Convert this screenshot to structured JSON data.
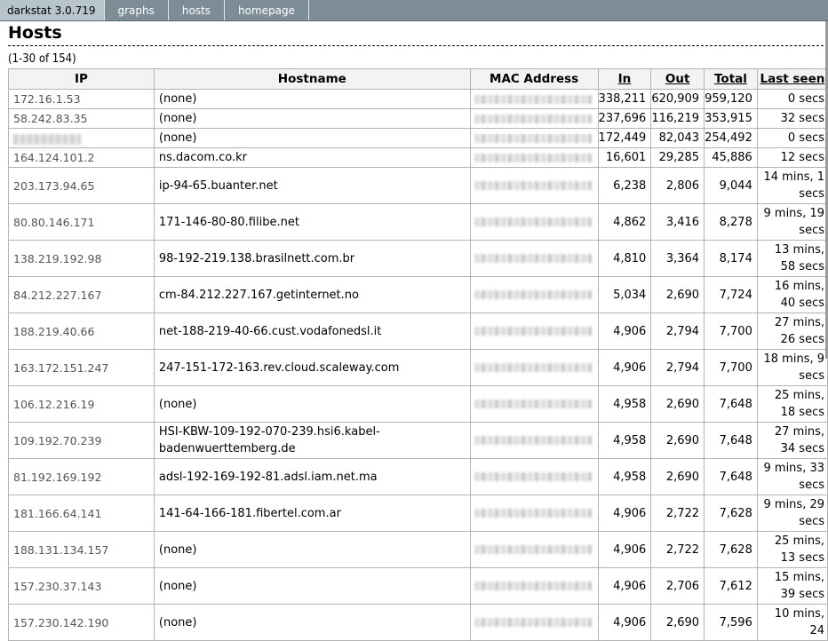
{
  "nav": {
    "brand": "darkstat 3.0.719",
    "links": [
      "graphs",
      "hosts",
      "homepage"
    ]
  },
  "page": {
    "title": "Hosts",
    "count": "(1-30 of 154)"
  },
  "table": {
    "headers": [
      "IP",
      "Hostname",
      "MAC Address",
      "In",
      "Out",
      "Total",
      "Last seen"
    ],
    "rows": [
      {
        "ip": "172.16.1.53",
        "host": "(none)",
        "in": "338,211",
        "out": "620,909",
        "total": "959,120",
        "seen": "0 secs"
      },
      {
        "ip": "58.242.83.35",
        "host": "(none)",
        "in": "237,696",
        "out": "116,219",
        "total": "353,915",
        "seen": "32 secs"
      },
      {
        "ip": "",
        "host": "(none)",
        "in": "172,449",
        "out": "82,043",
        "total": "254,492",
        "seen": "0 secs"
      },
      {
        "ip": "164.124.101.2",
        "host": "ns.dacom.co.kr",
        "in": "16,601",
        "out": "29,285",
        "total": "45,886",
        "seen": "12 secs"
      },
      {
        "ip": "203.173.94.65",
        "host": "ip-94-65.buanter.net",
        "in": "6,238",
        "out": "2,806",
        "total": "9,044",
        "seen": "14 mins, 1 secs"
      },
      {
        "ip": "80.80.146.171",
        "host": "171-146-80-80.filibe.net",
        "in": "4,862",
        "out": "3,416",
        "total": "8,278",
        "seen": "9 mins, 19 secs"
      },
      {
        "ip": "138.219.192.98",
        "host": "98-192-219.138.brasilnett.com.br",
        "in": "4,810",
        "out": "3,364",
        "total": "8,174",
        "seen": "13 mins, 58 secs"
      },
      {
        "ip": "84.212.227.167",
        "host": "cm-84.212.227.167.getinternet.no",
        "in": "5,034",
        "out": "2,690",
        "total": "7,724",
        "seen": "16 mins, 40 secs"
      },
      {
        "ip": "188.219.40.66",
        "host": "net-188-219-40-66.cust.vodafonedsl.it",
        "in": "4,906",
        "out": "2,794",
        "total": "7,700",
        "seen": "27 mins, 26 secs"
      },
      {
        "ip": "163.172.151.247",
        "host": "247-151-172-163.rev.cloud.scaleway.com",
        "in": "4,906",
        "out": "2,794",
        "total": "7,700",
        "seen": "18 mins, 9 secs"
      },
      {
        "ip": "106.12.216.19",
        "host": "(none)",
        "in": "4,958",
        "out": "2,690",
        "total": "7,648",
        "seen": "25 mins, 18 secs"
      },
      {
        "ip": "109.192.70.239",
        "host": "HSI-KBW-109-192-070-239.hsi6.kabel-badenwuerttemberg.de",
        "in": "4,958",
        "out": "2,690",
        "total": "7,648",
        "seen": "27 mins, 34 secs"
      },
      {
        "ip": "81.192.169.192",
        "host": "adsl-192-169-192-81.adsl.iam.net.ma",
        "in": "4,958",
        "out": "2,690",
        "total": "7,648",
        "seen": "9 mins, 33 secs"
      },
      {
        "ip": "181.166.64.141",
        "host": "141-64-166-181.fibertel.com.ar",
        "in": "4,906",
        "out": "2,722",
        "total": "7,628",
        "seen": "9 mins, 29 secs"
      },
      {
        "ip": "188.131.134.157",
        "host": "(none)",
        "in": "4,906",
        "out": "2,722",
        "total": "7,628",
        "seen": "25 mins, 13 secs"
      },
      {
        "ip": "157.230.37.143",
        "host": "(none)",
        "in": "4,906",
        "out": "2,706",
        "total": "7,612",
        "seen": "15 mins, 39 secs"
      },
      {
        "ip": "157.230.142.190",
        "host": "(none)",
        "in": "4,906",
        "out": "2,690",
        "total": "7,596",
        "seen": "10 mins, 24"
      }
    ]
  }
}
